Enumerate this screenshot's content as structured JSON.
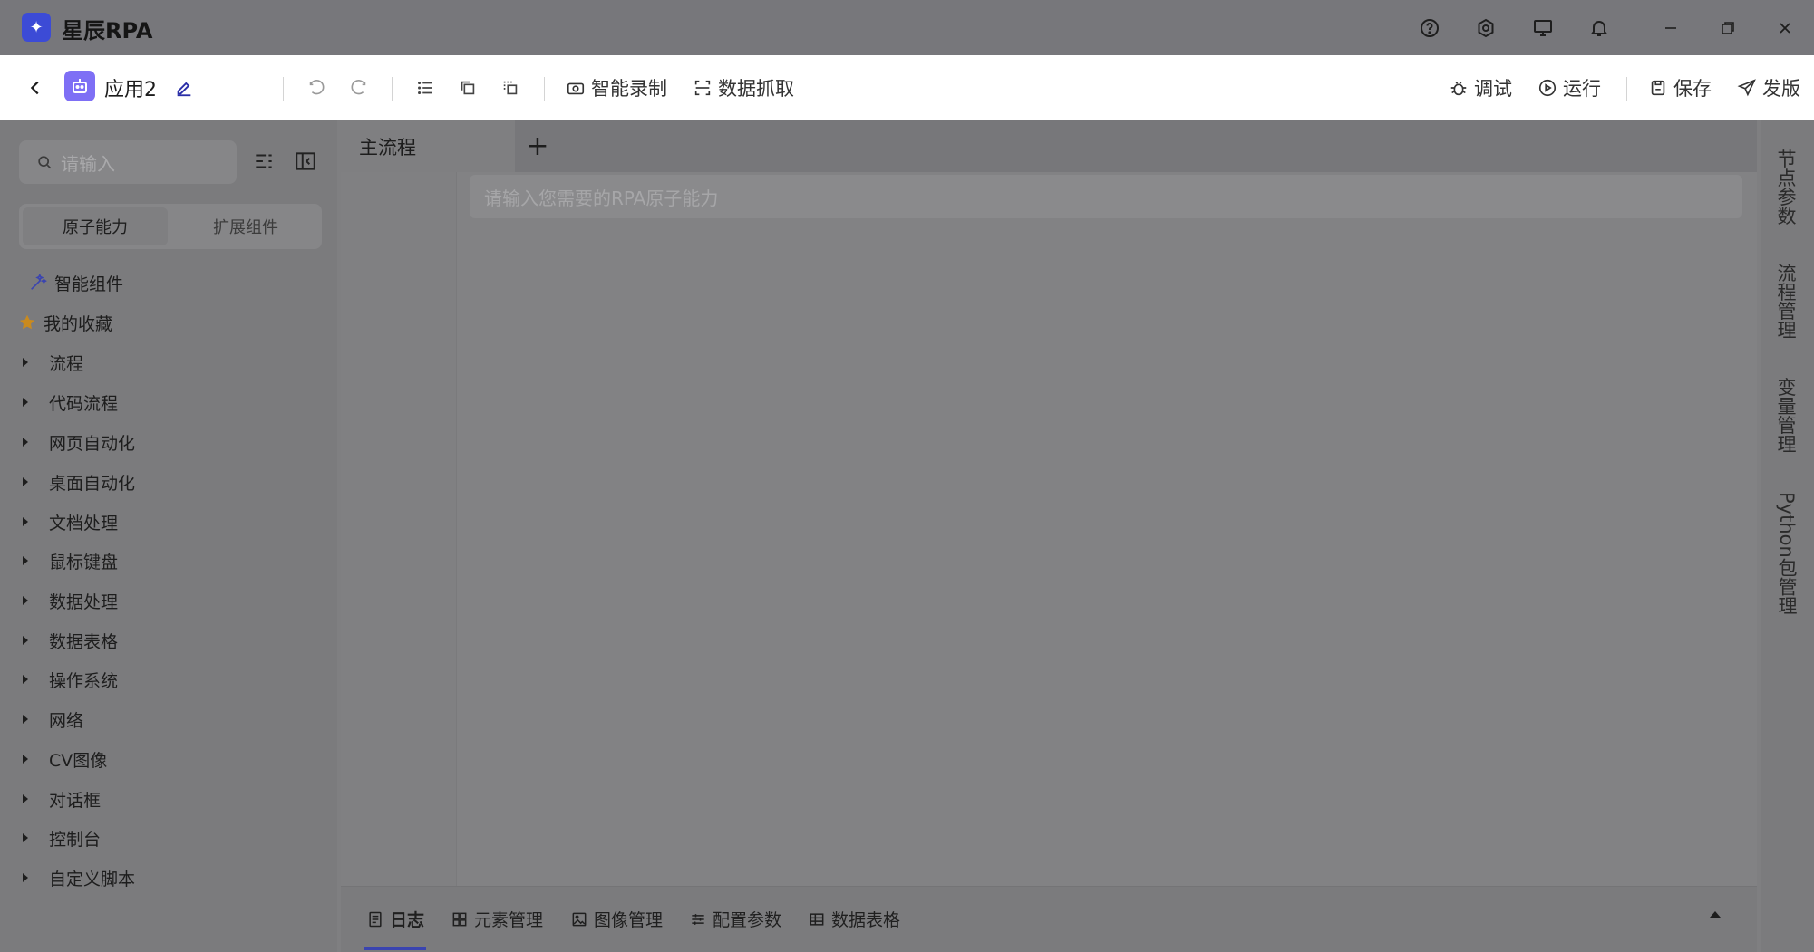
{
  "titlebar": {
    "logo_glyph": "✦",
    "app_name": "星辰RPA",
    "icons": [
      "help-icon",
      "settings-icon",
      "monitor-icon",
      "bell-icon",
      "minimize-icon",
      "restore-icon",
      "close-icon"
    ]
  },
  "toolbar": {
    "project_name": "应用2",
    "smart_record": "智能录制",
    "data_capture": "数据抓取",
    "debug": "调试",
    "run": "运行",
    "save": "保存",
    "publish": "发版"
  },
  "sidebar": {
    "search_placeholder": "请输入",
    "seg_atomic": "原子能力",
    "seg_extension": "扩展组件",
    "smart_component": "智能组件",
    "favorites": "我的收藏",
    "categories": [
      "流程",
      "代码流程",
      "网页自动化",
      "桌面自动化",
      "文档处理",
      "鼠标键盘",
      "数据处理",
      "数据表格",
      "操作系统",
      "网络",
      "CV图像",
      "对话框",
      "控制台",
      "自定义脚本"
    ]
  },
  "editor": {
    "main_tab": "主流程",
    "add_tab": "+",
    "atom_search_placeholder": "请输入您需要的RPA原子能力"
  },
  "bottom_tabs": {
    "log": "日志",
    "elements": "元素管理",
    "images": "图像管理",
    "config": "配置参数",
    "data_table": "数据表格"
  },
  "right_sidebar": {
    "node_params": "节点参数",
    "flow_management": "流程管理",
    "variable_management": "变量管理",
    "python_packages": "Python包管理"
  },
  "colors": {
    "accent": "#3a44b0",
    "robot_avatar": "#7e6ff5",
    "favorite_star": "#c98a1e"
  }
}
